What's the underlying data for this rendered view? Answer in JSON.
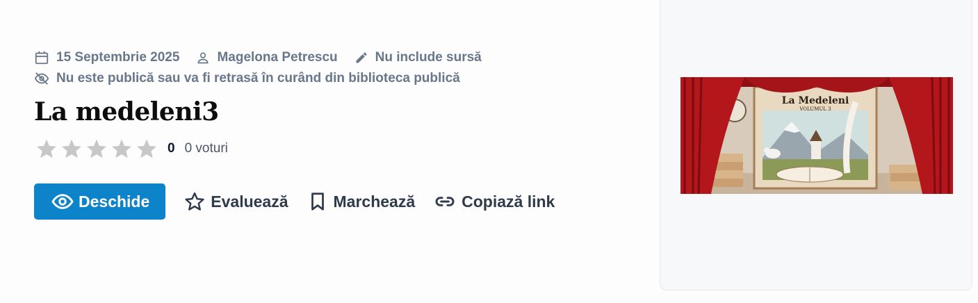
{
  "meta": {
    "date": "15 Septembrie 2025",
    "author": "Magelona Petrescu",
    "source": "Nu include sursă",
    "visibility": "Nu este publică sau va fi retrasă în curând din biblioteca publică"
  },
  "title": "La medeleni3",
  "rating": {
    "value": "0",
    "votes": "0 voturi",
    "stars_filled": 0,
    "stars_total": 5
  },
  "actions": {
    "open": "Deschide",
    "rate": "Evaluează",
    "bookmark": "Marchează",
    "copy_link": "Copiază link"
  },
  "cover": {
    "title": "La Medeleni",
    "subtitle": "VOLUMUL 3"
  },
  "colors": {
    "primary": "#0d84c9",
    "muted": "#68778a",
    "star_empty": "#c7c7c7",
    "curtain": "#b3161b"
  }
}
